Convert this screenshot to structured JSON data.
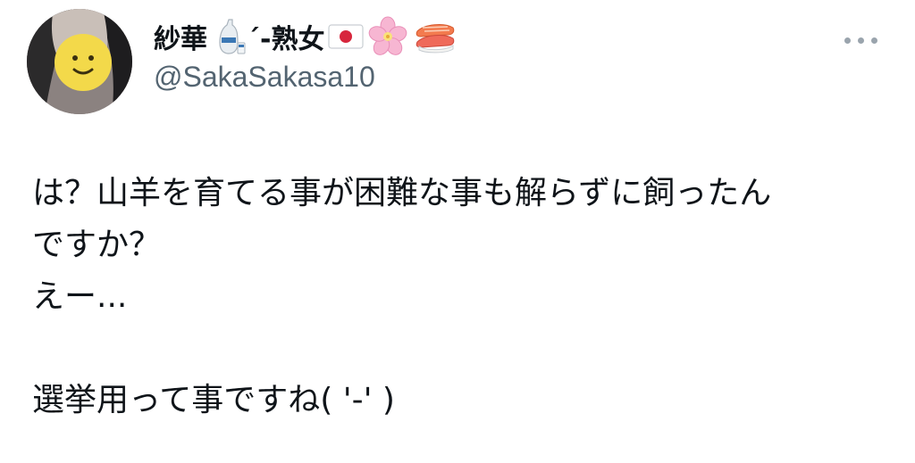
{
  "tweet": {
    "author": {
      "display_name": "紗華",
      "display_name_suffix": "´-熟女",
      "emojis": [
        "sake-icon",
        "japan-flag-icon",
        "cherry-blossom-icon",
        "sushi-icon"
      ],
      "handle": "@SakaSakasa10"
    },
    "more_icon": "more-options-icon",
    "text_lines": [
      "は？山羊を育てる事が困難な事も解らずに飼ったん",
      "ですか？",
      "えー...",
      "",
      "選挙用って事ですね( '-' )"
    ]
  }
}
